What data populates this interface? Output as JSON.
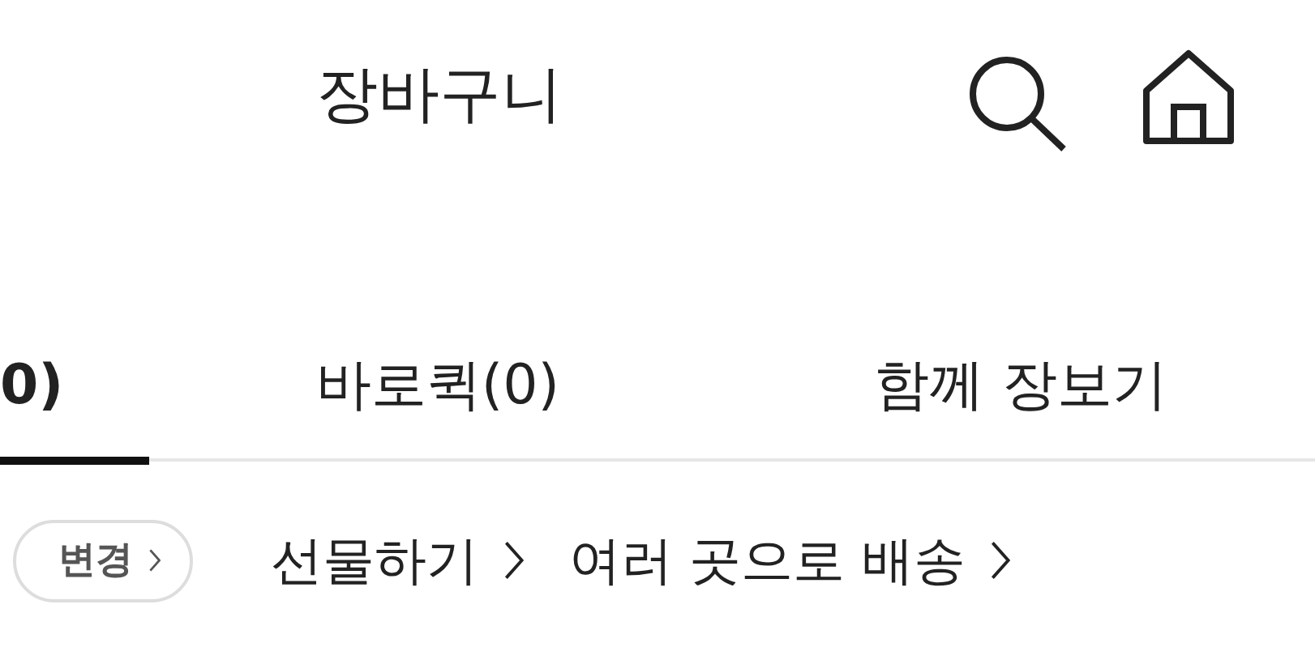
{
  "header": {
    "title": "장바구니"
  },
  "tabs": [
    {
      "label": "0)",
      "selected": true
    },
    {
      "label": "바로퀵(0)",
      "selected": false
    },
    {
      "label": "함께 장보기",
      "selected": false
    }
  ],
  "actions": {
    "change_button": "변경",
    "links": [
      "선물하기",
      "여러 곳으로 배송"
    ]
  }
}
